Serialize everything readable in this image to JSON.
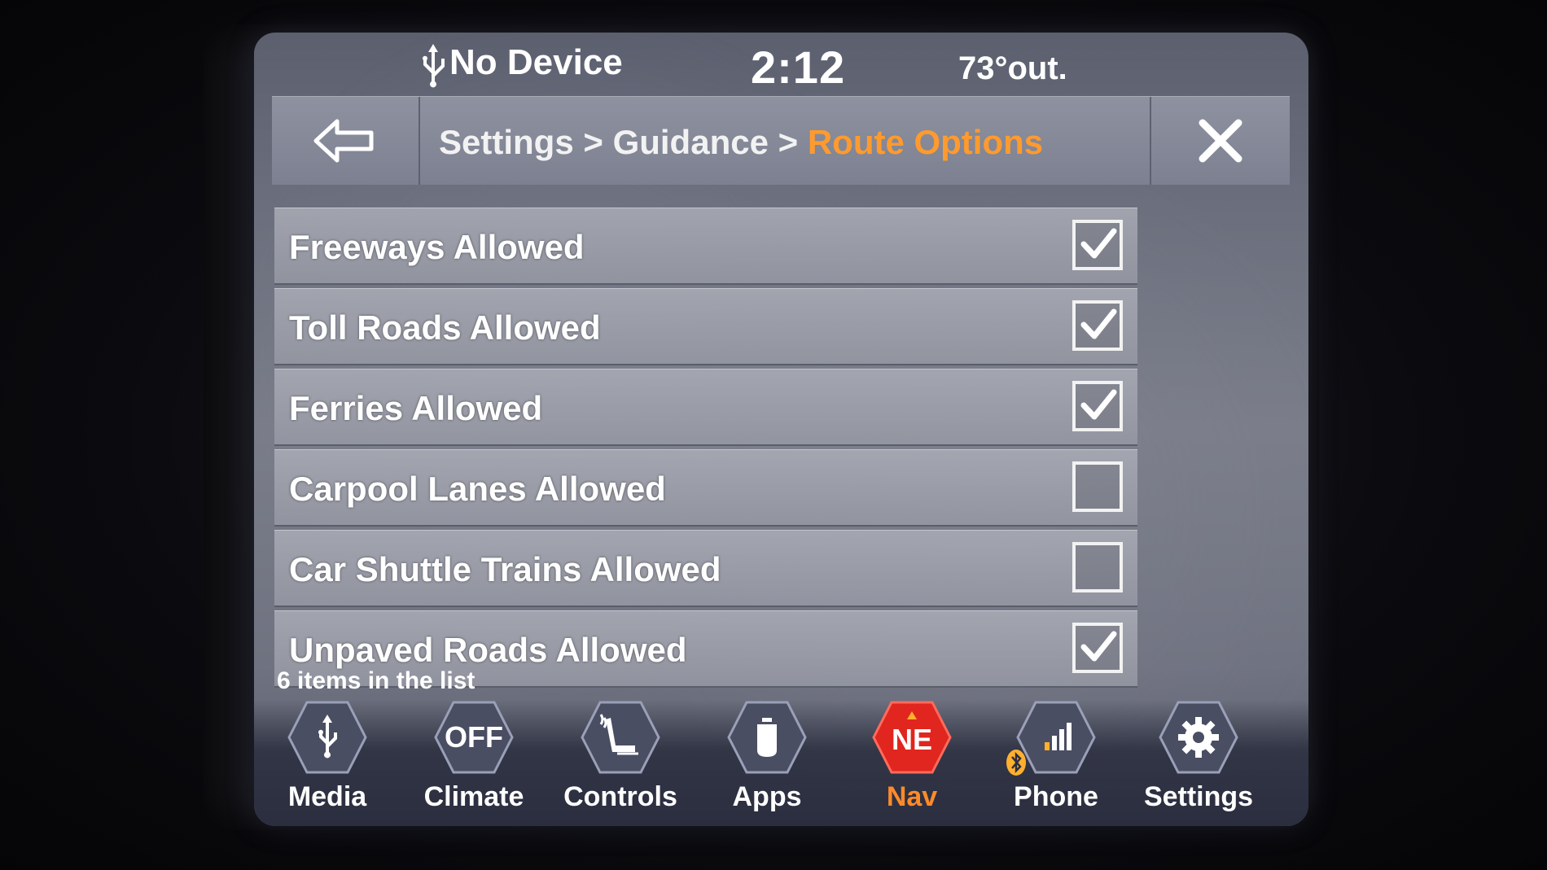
{
  "status": {
    "device": "No Device",
    "time": "2:12",
    "temperature": "73°out."
  },
  "header": {
    "crumb_1": "Settings",
    "sep_1": " > ",
    "crumb_2": "Guidance",
    "sep_2": " > ",
    "crumb_active": "Route Options"
  },
  "route_options": [
    {
      "label": "Freeways Allowed",
      "checked": true
    },
    {
      "label": "Toll Roads Allowed",
      "checked": true
    },
    {
      "label": "Ferries Allowed",
      "checked": true
    },
    {
      "label": "Carpool Lanes Allowed",
      "checked": false
    },
    {
      "label": "Car Shuttle Trains Allowed",
      "checked": false
    },
    {
      "label": "Unpaved Roads Allowed",
      "checked": true
    }
  ],
  "list_count": "6 items in the list",
  "nav": {
    "media": "Media",
    "climate_badge": "OFF",
    "climate": "Climate",
    "controls": "Controls",
    "apps": "Apps",
    "nav_heading": "NE",
    "nav": "Nav",
    "phone": "Phone",
    "settings": "Settings"
  },
  "colors": {
    "accent": "#ff9a2e",
    "nav_active": "#e0261e"
  }
}
